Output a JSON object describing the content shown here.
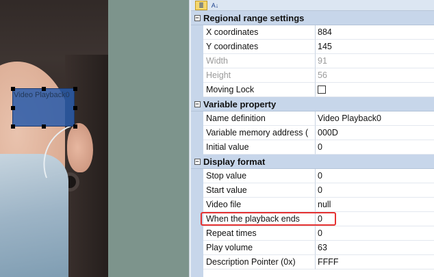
{
  "canvas": {
    "widget_label": "Video Playback0"
  },
  "toolbar": {
    "buttons": [
      {
        "icon": "categorized-sort-icon",
        "label": "≣",
        "active": true
      },
      {
        "icon": "alphabetical-sort-icon",
        "label": "A↓",
        "active": false
      }
    ]
  },
  "properties": {
    "sections": [
      {
        "title": "Regional range settings",
        "rows": [
          {
            "name": "X coordinates",
            "value": "884"
          },
          {
            "name": "Y coordinates",
            "value": "145"
          },
          {
            "name": "Width",
            "value": "91",
            "disabled": true
          },
          {
            "name": "Height",
            "value": "56",
            "disabled": true
          },
          {
            "name": "Moving Lock",
            "value": "",
            "checkbox": true
          }
        ]
      },
      {
        "title": "Variable property",
        "rows": [
          {
            "name": "Name definition",
            "value": "Video Playback0"
          },
          {
            "name": "Variable memory address (",
            "value": "000D"
          },
          {
            "name": "Initial value",
            "value": "0"
          }
        ]
      },
      {
        "title": "Display format",
        "rows": [
          {
            "name": "Stop value",
            "value": "0"
          },
          {
            "name": "Start value",
            "value": "0"
          },
          {
            "name": "Video file",
            "value": "null"
          },
          {
            "name": "When the playback ends",
            "value": "0"
          },
          {
            "name": "Repeat times",
            "value": "0"
          },
          {
            "name": "Play volume",
            "value": "63"
          },
          {
            "name": "Description Pointer (0x)",
            "value": "FFFF"
          }
        ]
      }
    ]
  },
  "colors": {
    "highlight": "#e53030",
    "widget_fill": "#285aaa",
    "category_bg": "#c7d6ea"
  }
}
